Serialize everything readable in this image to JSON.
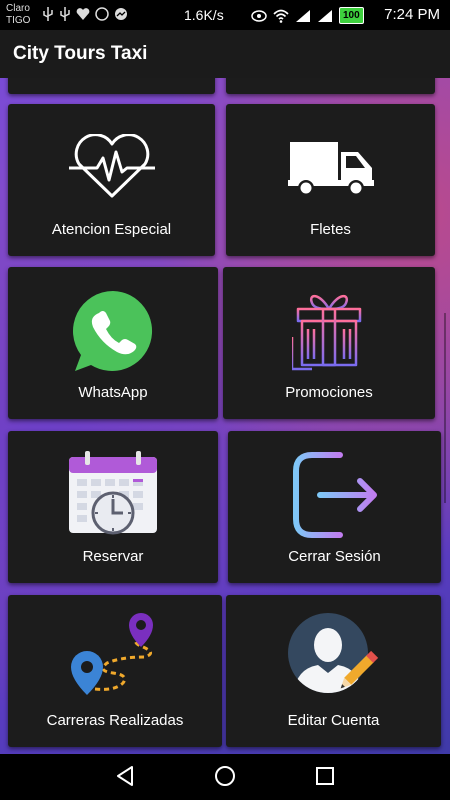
{
  "status_bar": {
    "carrier_line1": "Claro",
    "carrier_line2": "TIGO",
    "speed": "1.6K/s",
    "battery": "100",
    "time": "7:24 PM"
  },
  "app_bar": {
    "title": "City Tours Taxi"
  },
  "tiles": [
    {
      "label": "Atencion Especial",
      "icon": "heart-pulse-icon"
    },
    {
      "label": "Fletes",
      "icon": "truck-icon"
    },
    {
      "label": "WhatsApp",
      "icon": "whatsapp-icon"
    },
    {
      "label": "Promociones",
      "icon": "gift-icon"
    },
    {
      "label": "Reservar",
      "icon": "calendar-icon"
    },
    {
      "label": "Cerrar Sesión",
      "icon": "logout-icon"
    },
    {
      "label": "Carreras Realizadas",
      "icon": "route-map-icon"
    },
    {
      "label": "Editar Cuenta",
      "icon": "user-edit-icon"
    }
  ],
  "colors": {
    "tile_bg": "#1c1c1c",
    "whatsapp_green": "#4bc25a",
    "calendar_header": "#b05ad8",
    "logout_gradient_start": "#7fc7f7",
    "logout_gradient_end": "#c07ef0"
  }
}
